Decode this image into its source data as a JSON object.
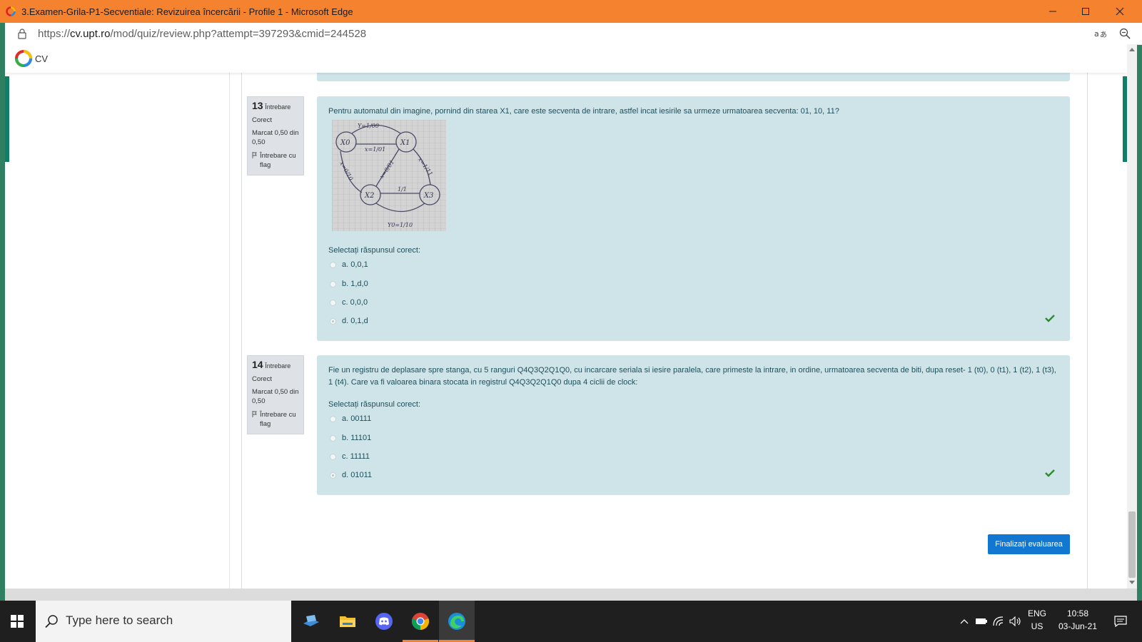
{
  "window": {
    "title": "3.Examen-Grila-P1-Secventiale: Revizuirea încercării - Profile 1 - Microsoft Edge"
  },
  "address_bar": {
    "url_prefix": "https://",
    "url_host": "cv.upt.ro",
    "url_path": "/mod/quiz/review.php?attempt=397293&cmid=244528"
  },
  "site": {
    "brand": "CV"
  },
  "questions": [
    {
      "number": "13",
      "word": "Întrebare",
      "status": "Corect",
      "mark": "Marcat 0,50 din 0,50",
      "flag_label": "Întrebare cu flag",
      "text": "Pentru automatul din imagine, pornind din starea X1, care este secventa de intrare, astfel incat iesirile sa urmeze urmatoarea secventa: 01, 10, 11?",
      "prompt": "Selectați răspunsul corect:",
      "diagram_labels": {
        "x0": "X0",
        "x1": "X1",
        "x2": "X2",
        "x3": "X3",
        "top": "Y=1/00",
        "mid": "x=1/01",
        "diag": "x=0/01",
        "right": "x=1/11",
        "left": "x=0/10",
        "bottom_edge": "1/1",
        "bottom": "Y0=1/10"
      },
      "answers": [
        {
          "label": "a. 0,0,1",
          "checked": false
        },
        {
          "label": "b. 1,d,0",
          "checked": false
        },
        {
          "label": "c. 0,0,0",
          "checked": false
        },
        {
          "label": "d. 0,1,d",
          "checked": true
        }
      ]
    },
    {
      "number": "14",
      "word": "Întrebare",
      "status": "Corect",
      "mark": "Marcat 0,50 din 0,50",
      "flag_label": "Întrebare cu flag",
      "text": "Fie un registru de deplasare spre stanga, cu 5 ranguri Q4Q3Q2Q1Q0, cu incarcare seriala si iesire paralela, care primeste la intrare, in ordine, urmatoarea secventa de biti, dupa reset- 1 (t0), 0 (t1), 1 (t2), 1 (t3), 1 (t4). Care va fi valoarea binara stocata in registrul Q4Q3Q2Q1Q0 dupa 4 ciclii de clock:",
      "prompt": "Selectați răspunsul corect:",
      "answers": [
        {
          "label": "a. 00111",
          "checked": false
        },
        {
          "label": "b. 11101",
          "checked": false
        },
        {
          "label": "c. 11111",
          "checked": false
        },
        {
          "label": "d. 01011",
          "checked": true
        }
      ]
    }
  ],
  "finish_button": "Finalizați evaluarea",
  "taskbar": {
    "search_placeholder": "Type here to search",
    "apps": [
      "task-view",
      "file-explorer",
      "discord",
      "chrome",
      "edge"
    ],
    "language_line1": "ENG",
    "language_line2": "US",
    "time": "10:58",
    "date": "03-Jun-21"
  },
  "colors": {
    "titlebar": "#f5822e",
    "question_bg": "#cfe4e9",
    "info_bg": "#dee2e6",
    "button": "#1177d1",
    "check": "#2e8b2e"
  }
}
